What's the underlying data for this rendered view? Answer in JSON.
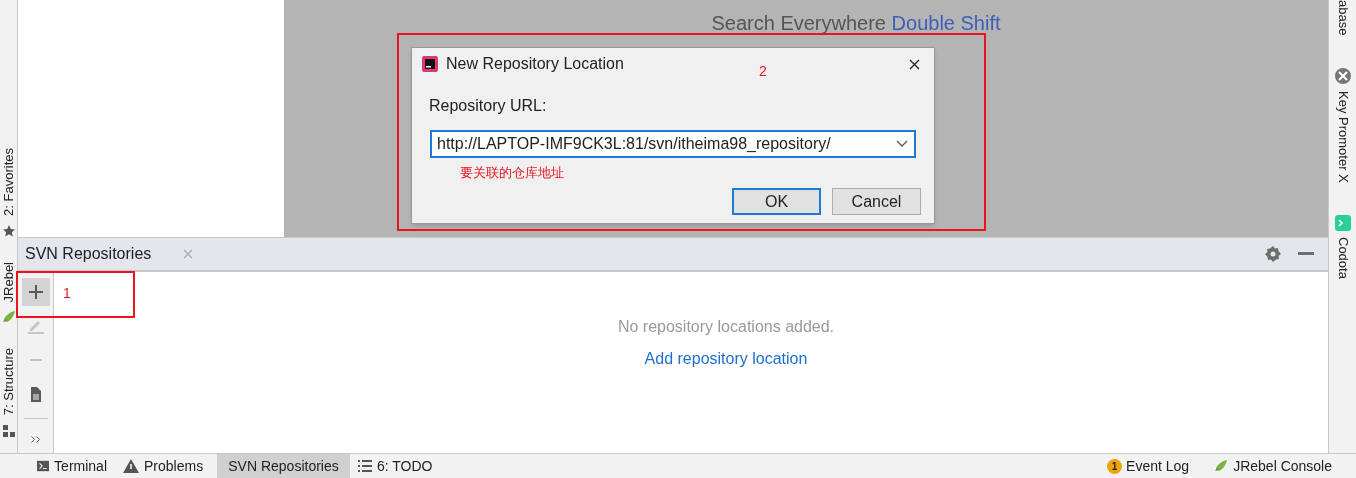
{
  "left_stripe": [
    {
      "label": "2: Favorites"
    },
    {
      "label": "JRebel"
    },
    {
      "label": "7: Structure"
    }
  ],
  "right_stripe": [
    {
      "label": "abase"
    },
    {
      "label": "Key Promoter X"
    },
    {
      "label": "Codota"
    }
  ],
  "editor": {
    "search_hint": "Search Everywhere",
    "search_shortcut": "Double Shift"
  },
  "dialog": {
    "title": "New Repository Location",
    "field_label": "Repository URL:",
    "url": "http://LAPTOP-IMF9CK3L:81/svn/itheima98_repository/",
    "buttons": [
      {
        "label": "OK",
        "default": true
      },
      {
        "label": "Cancel",
        "default": false
      }
    ]
  },
  "annotations": {
    "dialog_mark": "2",
    "add_mark": "1",
    "note": "要关联的仓库地址"
  },
  "tool_window": {
    "title": "SVN Repositories",
    "toolbar": [
      {
        "kind": "add",
        "selected": true,
        "disabled": false
      },
      {
        "kind": "edit",
        "selected": false,
        "disabled": true
      },
      {
        "kind": "remove",
        "selected": false,
        "disabled": true
      },
      {
        "kind": "document",
        "selected": false,
        "disabled": false
      },
      {
        "kind": "more",
        "selected": false,
        "disabled": false
      }
    ],
    "empty_text": "No repository locations added.",
    "link": "Add repository location"
  },
  "bottom_tabs": [
    {
      "label": "Terminal",
      "selected": false
    },
    {
      "label": "Problems",
      "selected": false
    },
    {
      "label": "SVN Repositories",
      "selected": true
    },
    {
      "label": "6: TODO",
      "selected": false
    }
  ],
  "status_right": [
    {
      "label": "Event Log",
      "badge": "1"
    },
    {
      "label": "JRebel Console"
    }
  ]
}
